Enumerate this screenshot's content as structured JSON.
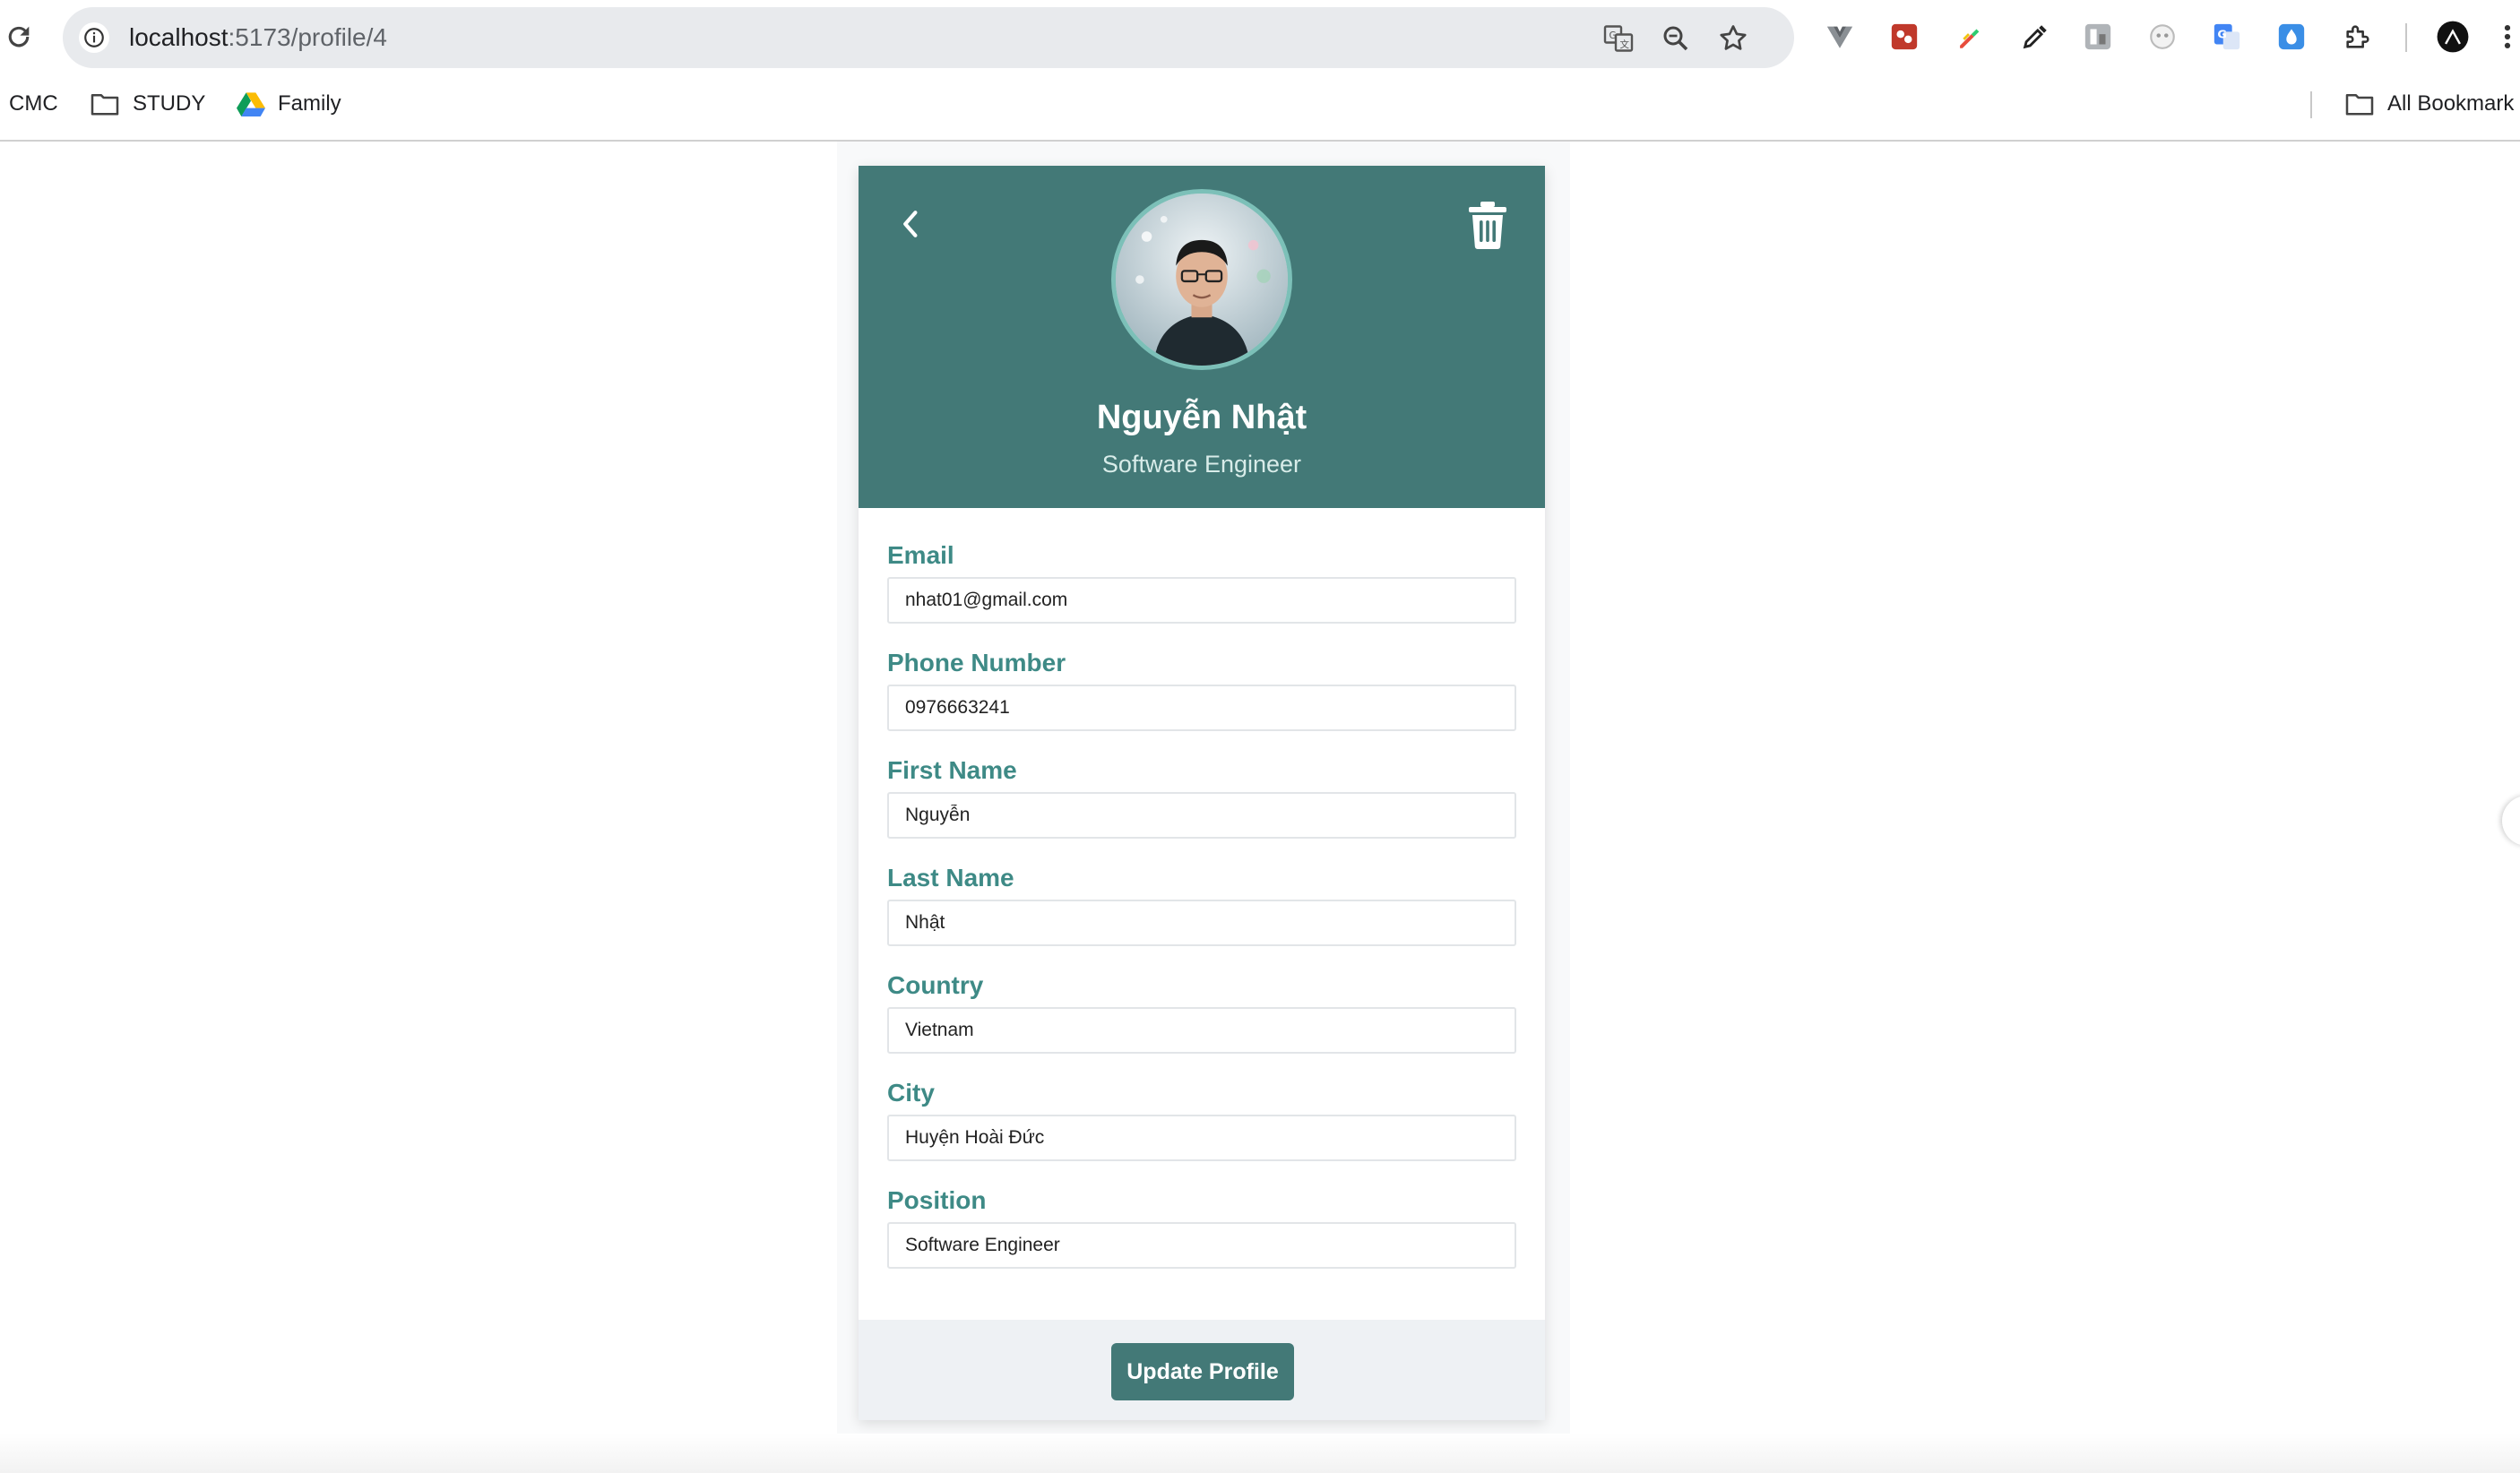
{
  "browser": {
    "url_host": "localhost",
    "url_path": ":5173/profile/4",
    "icons": [
      "reload-icon",
      "site-info-icon",
      "translate-icon",
      "zoom-icon",
      "bookmark-star-icon"
    ],
    "extensions": [
      "vue-devtools-icon",
      "extension-red-icon",
      "color-picker-icon",
      "eyedropper-icon",
      "extension-gray-icon",
      "extension-panda-icon",
      "google-translate-icon",
      "extension-drop-icon",
      "extensions-puzzle-icon",
      "profile-avatar-icon",
      "menu-kebab-icon"
    ]
  },
  "bookmarks": {
    "items": [
      {
        "label": "CMC"
      },
      {
        "label": "STUDY"
      },
      {
        "label": "Family"
      }
    ],
    "all_label": "All Bookmark"
  },
  "profile": {
    "name": "Nguyễn Nhật",
    "position": "Software Engineer"
  },
  "fields": [
    {
      "label": "Email",
      "value": "nhat01@gmail.com"
    },
    {
      "label": "Phone Number",
      "value": "0976663241"
    },
    {
      "label": "First Name",
      "value": "Nguyễn"
    },
    {
      "label": "Last Name",
      "value": "Nhật"
    },
    {
      "label": "Country",
      "value": "Vietnam"
    },
    {
      "label": "City",
      "value": "Huyện Hoài Đức"
    },
    {
      "label": "Position",
      "value": "Software Engineer"
    }
  ],
  "actions": {
    "update_label": "Update Profile"
  },
  "colors": {
    "header": "#437977",
    "label": "#3e8a86",
    "avatar_ring": "#7cc0b8"
  }
}
